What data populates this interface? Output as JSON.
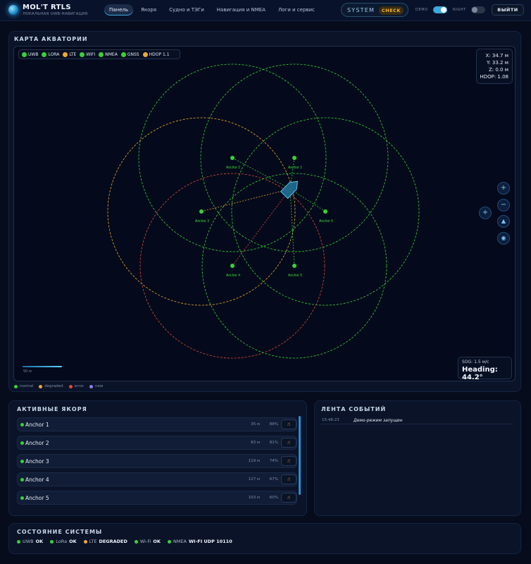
{
  "header": {
    "brand_title": "MOL'T RTLS",
    "brand_subtitle": "ЛОКАЛЬНАЯ UWB-НАВИГАЦИЯ",
    "nav": [
      {
        "label": "Панель",
        "active": true
      },
      {
        "label": "Якоря",
        "active": false
      },
      {
        "label": "Судно и ТЭГи",
        "active": false
      },
      {
        "label": "Навигация и NMEA",
        "active": false
      },
      {
        "label": "Логи и сервис",
        "active": false
      }
    ],
    "system_label": "SYSTEM",
    "check_label": "CHECK",
    "demo_label": "DEMO",
    "demo_on": true,
    "night_label": "NIGHT",
    "night_on": false,
    "logout_label": "ВЫЙТИ"
  },
  "map": {
    "title": "КАРТА АКВАТОРИИ",
    "chips": [
      {
        "label": "UWB",
        "color": "#37d336"
      },
      {
        "label": "LORA",
        "color": "#37d336"
      },
      {
        "label": "LTE",
        "color": "#f0a830"
      },
      {
        "label": "WIFI",
        "color": "#37d336"
      },
      {
        "label": "NMEA",
        "color": "#37d336"
      },
      {
        "label": "GNSS",
        "color": "#37d336"
      },
      {
        "label": "HDOP 1.1",
        "color": "#f0a830"
      }
    ],
    "coords": {
      "x": "X: 34.7 м",
      "y": "Y: 33.2 м",
      "z": "Z: 0.0 м",
      "hdop": "HDOP: 1.08"
    },
    "anchors": [
      {
        "name": "Anchor 1",
        "status": "normal"
      },
      {
        "name": "Anchor 2",
        "status": "normal"
      },
      {
        "name": "Anchor 3",
        "status": "normal"
      },
      {
        "name": "Anchor 4",
        "status": "normal"
      },
      {
        "name": "Anchor 5",
        "status": "normal"
      },
      {
        "name": "Anchor 6",
        "status": "normal"
      }
    ],
    "sog": "SOG: 1.5 м/с",
    "heading": "Heading: 44.2°",
    "scale_label": "50 м",
    "legend": [
      {
        "label": "normal",
        "color": "#37d336"
      },
      {
        "label": "degraded",
        "color": "#f0a830"
      },
      {
        "label": "error",
        "color": "#e04a3a"
      },
      {
        "label": "new",
        "color": "#8f7cf0"
      }
    ],
    "buttons": [
      {
        "icon": "zoom-in-icon",
        "glyph": "+"
      },
      {
        "icon": "zoom-out-icon",
        "glyph": "−"
      },
      {
        "icon": "locate-icon",
        "glyph": "+"
      },
      {
        "icon": "north-icon",
        "glyph": "▲"
      },
      {
        "icon": "layers-icon",
        "glyph": "◉"
      }
    ],
    "colors": {
      "ok": "#37d336",
      "warn": "#f0a830",
      "err": "#e04a3a",
      "vessel": "#3fb7e8"
    }
  },
  "anchors_panel": {
    "title": "АКТИВНЫЕ ЯКОРЯ",
    "rows": [
      {
        "name": "Anchor 1",
        "distance": "35 м",
        "quality": "88%"
      },
      {
        "name": "Anchor 2",
        "distance": "83 м",
        "quality": "81%"
      },
      {
        "name": "Anchor 3",
        "distance": "119 м",
        "quality": "74%"
      },
      {
        "name": "Anchor 4",
        "distance": "127 м",
        "quality": "67%"
      },
      {
        "name": "Anchor 5",
        "distance": "103 м",
        "quality": "60%"
      }
    ],
    "action_icon": "hand-pointer-icon"
  },
  "events_panel": {
    "title": "ЛЕНТА СОБЫТИЙ",
    "events": [
      {
        "time": "15:48:23",
        "text": "Демо-режим запущен"
      }
    ]
  },
  "status_panel": {
    "title": "СОСТОЯНИЕ СИСТЕМЫ",
    "items": [
      {
        "label": "UWB",
        "value": "OK",
        "color": "#37d336"
      },
      {
        "label": "LoRa",
        "value": "OK",
        "color": "#37d336"
      },
      {
        "label": "LTE",
        "value": "DEGRADED",
        "color": "#f0a830"
      },
      {
        "label": "Wi-Fi",
        "value": "OK",
        "color": "#37d336"
      },
      {
        "label": "NMEA",
        "value": "WI-FI UDP 10110",
        "color": "#37d336"
      }
    ]
  }
}
